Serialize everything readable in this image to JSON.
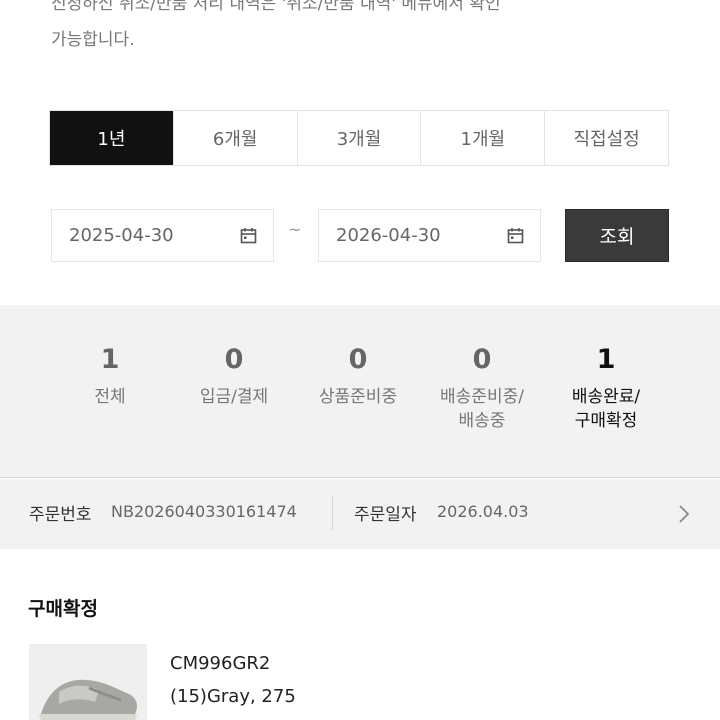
{
  "notice": {
    "line1": "신청하신 취소/반품 처리 내역은 '취소/반품 내역' 메뉴에서 확인",
    "line2": "가능합니다."
  },
  "period_tabs": [
    "1년",
    "6개월",
    "3개월",
    "1개월",
    "직접설정"
  ],
  "active_period": "1년",
  "date_range": {
    "start": "2025-04-30",
    "separator": "~",
    "end": "2026-04-30",
    "search_label": "조회"
  },
  "status_summary": [
    {
      "count": "1",
      "label": "전체"
    },
    {
      "count": "0",
      "label": "입금/결제"
    },
    {
      "count": "0",
      "label": "상품준비중"
    },
    {
      "count": "0",
      "label": "배송준비중/\n배송중"
    },
    {
      "count": "1",
      "label": "배송완료/\n구매확정"
    }
  ],
  "order": {
    "number_label": "주문번호",
    "number": "NB2026040330161474",
    "date_label": "주문일자",
    "date": "2026.04.03"
  },
  "section_title": "구매확정",
  "product": {
    "name": "CM996GR2",
    "option": "(15)Gray, 275"
  },
  "colors": {
    "active_tab": "#111111",
    "search_button": "#3a3a3a",
    "panel_bg": "#f2f2f2"
  },
  "icons": {
    "date": "calendar-icon",
    "order_link": "chevron-right-icon"
  }
}
